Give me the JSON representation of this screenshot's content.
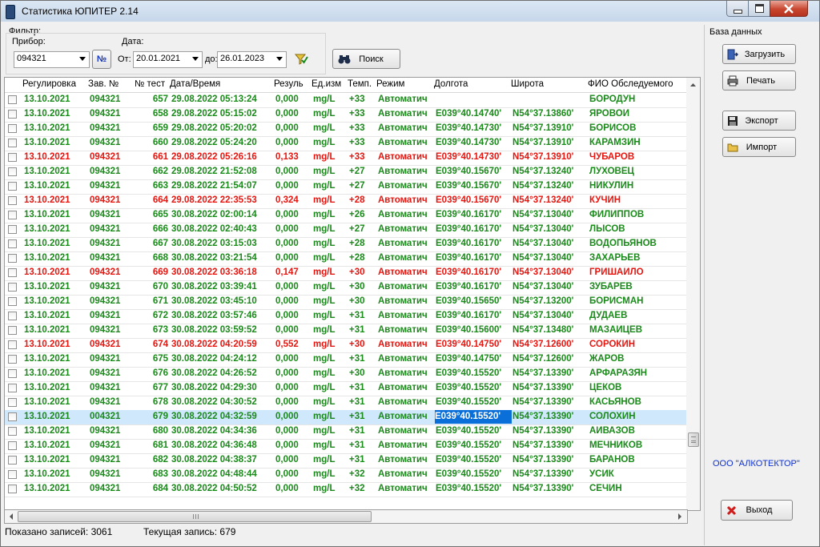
{
  "window": {
    "title": "Статистика ЮПИТЕР 2.14"
  },
  "filter": {
    "label": "Фильтр:",
    "device_label": "Прибор:",
    "device_value": "094321",
    "number_button": "№",
    "date_label": "Дата:",
    "from_label": "От:",
    "from_value": "20.01.2021",
    "to_label": "до:",
    "to_value": "26.01.2023",
    "search_label": "Поиск"
  },
  "database": {
    "label": "База данных",
    "load_label": "Загрузить",
    "print_label": "Печать",
    "export_label": "Экспорт",
    "import_label": "Импорт",
    "company": "ООО \"АЛКОТЕКТОР\"",
    "exit_label": "Выход"
  },
  "table": {
    "headers": [
      "Регулировка",
      "Зав. №",
      "№ тест",
      "Дата/Время",
      "Резуль",
      "Ед.изм",
      "Темп.",
      "Режим",
      "Долгота",
      "Широта",
      "ФИО Обследуемого"
    ],
    "rows": [
      {
        "status": "green",
        "cells": [
          "13.10.2021",
          "094321",
          "657",
          "29.08.2022 05:13:24",
          "0,000",
          "mg/L",
          "+33",
          "Автоматич",
          "",
          "",
          "БОРОДУН"
        ]
      },
      {
        "status": "green",
        "cells": [
          "13.10.2021",
          "094321",
          "658",
          "29.08.2022 05:15:02",
          "0,000",
          "mg/L",
          "+33",
          "Автоматич",
          "E039°40.14740'",
          "N54°37.13860'",
          "ЯРОВОЙ"
        ]
      },
      {
        "status": "green",
        "cells": [
          "13.10.2021",
          "094321",
          "659",
          "29.08.2022 05:20:02",
          "0,000",
          "mg/L",
          "+33",
          "Автоматич",
          "E039°40.14730'",
          "N54°37.13910'",
          "БОРИСОВ"
        ]
      },
      {
        "status": "green",
        "cells": [
          "13.10.2021",
          "094321",
          "660",
          "29.08.2022 05:24:20",
          "0,000",
          "mg/L",
          "+33",
          "Автоматич",
          "E039°40.14730'",
          "N54°37.13910'",
          "КАРАМЗИН"
        ]
      },
      {
        "status": "red",
        "cells": [
          "13.10.2021",
          "094321",
          "661",
          "29.08.2022 05:26:16",
          "0,133",
          "mg/L",
          "+33",
          "Автоматич",
          "E039°40.14730'",
          "N54°37.13910'",
          "ЧУБАРОВ"
        ]
      },
      {
        "status": "green",
        "cells": [
          "13.10.2021",
          "094321",
          "662",
          "29.08.2022 21:52:08",
          "0,000",
          "mg/L",
          "+27",
          "Автоматич",
          "E039°40.15670'",
          "N54°37.13240'",
          "ЛУХОВЕЦ"
        ]
      },
      {
        "status": "green",
        "cells": [
          "13.10.2021",
          "094321",
          "663",
          "29.08.2022 21:54:07",
          "0,000",
          "mg/L",
          "+27",
          "Автоматич",
          "E039°40.15670'",
          "N54°37.13240'",
          "НИКУЛИН"
        ]
      },
      {
        "status": "red",
        "cells": [
          "13.10.2021",
          "094321",
          "664",
          "29.08.2022 22:35:53",
          "0,324",
          "mg/L",
          "+28",
          "Автоматич",
          "E039°40.15670'",
          "N54°37.13240'",
          "КУЧИН"
        ]
      },
      {
        "status": "green",
        "cells": [
          "13.10.2021",
          "094321",
          "665",
          "30.08.2022 02:00:14",
          "0,000",
          "mg/L",
          "+26",
          "Автоматич",
          "E039°40.16170'",
          "N54°37.13040'",
          "ФИЛИППОВ"
        ]
      },
      {
        "status": "green",
        "cells": [
          "13.10.2021",
          "094321",
          "666",
          "30.08.2022 02:40:43",
          "0,000",
          "mg/L",
          "+27",
          "Автоматич",
          "E039°40.16170'",
          "N54°37.13040'",
          "ЛЫСОВ"
        ]
      },
      {
        "status": "green",
        "cells": [
          "13.10.2021",
          "094321",
          "667",
          "30.08.2022 03:15:03",
          "0,000",
          "mg/L",
          "+28",
          "Автоматич",
          "E039°40.16170'",
          "N54°37.13040'",
          "ВОДОПЬЯНОВ"
        ]
      },
      {
        "status": "green",
        "cells": [
          "13.10.2021",
          "094321",
          "668",
          "30.08.2022 03:21:54",
          "0,000",
          "mg/L",
          "+28",
          "Автоматич",
          "E039°40.16170'",
          "N54°37.13040'",
          "ЗАХАРЬЕВ"
        ]
      },
      {
        "status": "red",
        "cells": [
          "13.10.2021",
          "094321",
          "669",
          "30.08.2022 03:36:18",
          "0,147",
          "mg/L",
          "+30",
          "Автоматич",
          "E039°40.16170'",
          "N54°37.13040'",
          "ГРИШАЙЛО"
        ]
      },
      {
        "status": "green",
        "cells": [
          "13.10.2021",
          "094321",
          "670",
          "30.08.2022 03:39:41",
          "0,000",
          "mg/L",
          "+30",
          "Автоматич",
          "E039°40.16170'",
          "N54°37.13040'",
          "ЗУБАРЕВ"
        ]
      },
      {
        "status": "green",
        "cells": [
          "13.10.2021",
          "094321",
          "671",
          "30.08.2022 03:45:10",
          "0,000",
          "mg/L",
          "+30",
          "Автоматич",
          "E039°40.15650'",
          "N54°37.13200'",
          "БОРИСМАН"
        ]
      },
      {
        "status": "green",
        "cells": [
          "13.10.2021",
          "094321",
          "672",
          "30.08.2022 03:57:46",
          "0,000",
          "mg/L",
          "+31",
          "Автоматич",
          "E039°40.16170'",
          "N54°37.13040'",
          "ДУДАЕВ"
        ]
      },
      {
        "status": "green",
        "cells": [
          "13.10.2021",
          "094321",
          "673",
          "30.08.2022 03:59:52",
          "0,000",
          "mg/L",
          "+31",
          "Автоматич",
          "E039°40.15600'",
          "N54°37.13480'",
          "МАЗАЙЦЕВ"
        ]
      },
      {
        "status": "red",
        "cells": [
          "13.10.2021",
          "094321",
          "674",
          "30.08.2022 04:20:59",
          "0,552",
          "mg/L",
          "+30",
          "Автоматич",
          "E039°40.14750'",
          "N54°37.12600'",
          "СОРОКИН"
        ]
      },
      {
        "status": "green",
        "cells": [
          "13.10.2021",
          "094321",
          "675",
          "30.08.2022 04:24:12",
          "0,000",
          "mg/L",
          "+31",
          "Автоматич",
          "E039°40.14750'",
          "N54°37.12600'",
          "ЖАРОВ"
        ]
      },
      {
        "status": "green",
        "cells": [
          "13.10.2021",
          "094321",
          "676",
          "30.08.2022 04:26:52",
          "0,000",
          "mg/L",
          "+30",
          "Автоматич",
          "E039°40.15520'",
          "N54°37.13390'",
          "АРФАРАЗЯН"
        ]
      },
      {
        "status": "green",
        "cells": [
          "13.10.2021",
          "094321",
          "677",
          "30.08.2022 04:29:30",
          "0,000",
          "mg/L",
          "+31",
          "Автоматич",
          "E039°40.15520'",
          "N54°37.13390'",
          "ЦЕКОВ"
        ]
      },
      {
        "status": "green",
        "cells": [
          "13.10.2021",
          "094321",
          "678",
          "30.08.2022 04:30:52",
          "0,000",
          "mg/L",
          "+31",
          "Автоматич",
          "E039°40.15520'",
          "N54°37.13390'",
          "КАСЬЯНОВ"
        ]
      },
      {
        "status": "sel",
        "cells": [
          "13.10.2021",
          "004321",
          "679",
          "30.08.2022 04:32:59",
          "0,000",
          "mg/L",
          "+31",
          "Автоматич",
          "E039°40.15520'",
          "N54°37.13390'",
          "СОЛОХИН"
        ]
      },
      {
        "status": "green",
        "cells": [
          "13.10.2021",
          "094321",
          "680",
          "30.08.2022 04:34:36",
          "0,000",
          "mg/L",
          "+31",
          "Автоматич",
          "E039°40.15520'",
          "N54°37.13390'",
          "АЙВАЗОВ"
        ]
      },
      {
        "status": "green",
        "cells": [
          "13.10.2021",
          "094321",
          "681",
          "30.08.2022 04:36:48",
          "0,000",
          "mg/L",
          "+31",
          "Автоматич",
          "E039°40.15520'",
          "N54°37.13390'",
          "МЕЧНИКОВ"
        ]
      },
      {
        "status": "green",
        "cells": [
          "13.10.2021",
          "094321",
          "682",
          "30.08.2022 04:38:37",
          "0,000",
          "mg/L",
          "+31",
          "Автоматич",
          "E039°40.15520'",
          "N54°37.13390'",
          "БАРАНОВ"
        ]
      },
      {
        "status": "green",
        "cells": [
          "13.10.2021",
          "094321",
          "683",
          "30.08.2022 04:48:44",
          "0,000",
          "mg/L",
          "+32",
          "Автоматич",
          "E039°40.15520'",
          "N54°37.13390'",
          "УСИК"
        ]
      },
      {
        "status": "green",
        "cells": [
          "13.10.2021",
          "094321",
          "684",
          "30.08.2022 04:50:52",
          "0,000",
          "mg/L",
          "+32",
          "Автоматич",
          "E039°40.15520'",
          "N54°37.13390'",
          "СЕЧИН"
        ]
      }
    ]
  },
  "status": {
    "shown": "Показано записей: 3061",
    "current": "Текущая запись: 679"
  }
}
